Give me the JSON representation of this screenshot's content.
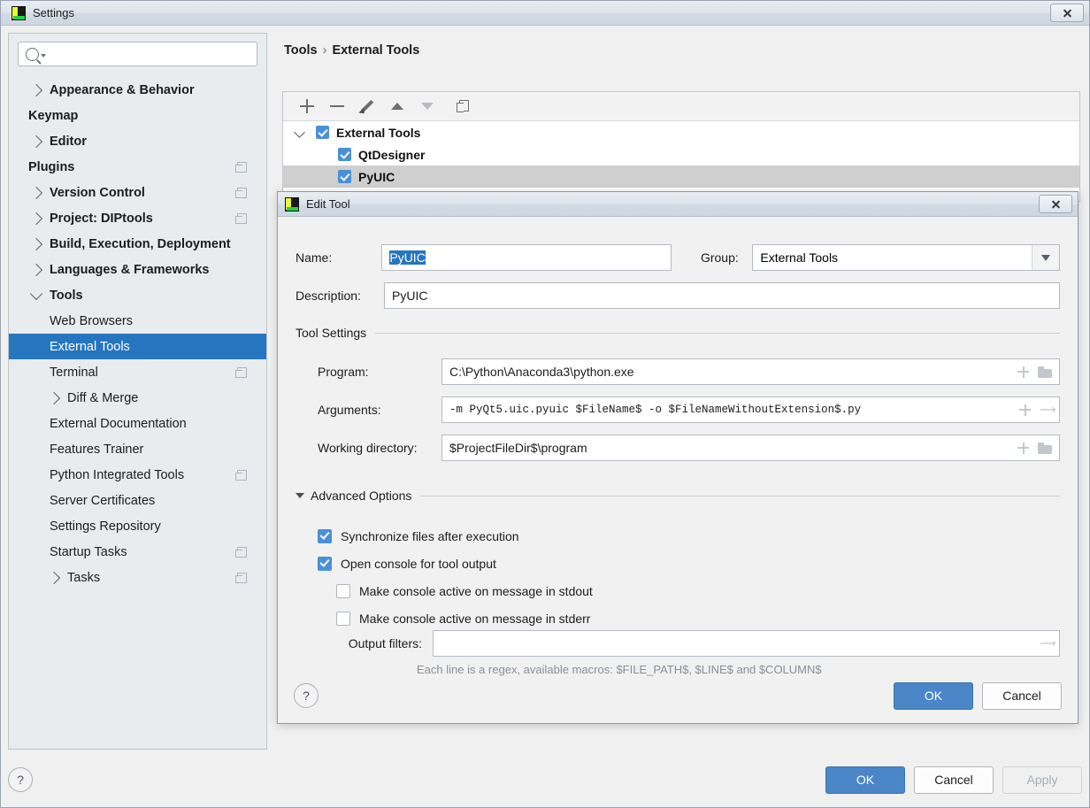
{
  "window": {
    "title": "Settings",
    "close_label": "Close",
    "app_icon": "pycharm-icon"
  },
  "search": {
    "placeholder": "",
    "icon": "search-icon"
  },
  "sidebar": {
    "items": [
      {
        "label": "Appearance & Behavior",
        "level": "top",
        "chevron": "right",
        "copy": false
      },
      {
        "label": "Keymap",
        "level": "top",
        "chevron": "none",
        "copy": false
      },
      {
        "label": "Editor",
        "level": "top",
        "chevron": "right",
        "copy": false
      },
      {
        "label": "Plugins",
        "level": "top",
        "chevron": "none",
        "copy": true
      },
      {
        "label": "Version Control",
        "level": "top",
        "chevron": "right",
        "copy": true
      },
      {
        "label": "Project: DIPtools",
        "level": "top",
        "chevron": "right",
        "copy": true
      },
      {
        "label": "Build, Execution, Deployment",
        "level": "top",
        "chevron": "right",
        "copy": false
      },
      {
        "label": "Languages & Frameworks",
        "level": "top",
        "chevron": "right",
        "copy": false
      },
      {
        "label": "Tools",
        "level": "top",
        "chevron": "down",
        "copy": false
      },
      {
        "label": "Web Browsers",
        "level": "child",
        "chevron": "none",
        "copy": false
      },
      {
        "label": "External Tools",
        "level": "child",
        "chevron": "none",
        "copy": false,
        "selected": true
      },
      {
        "label": "Terminal",
        "level": "child",
        "chevron": "none",
        "copy": true
      },
      {
        "label": "Diff & Merge",
        "level": "child",
        "chevron": "right",
        "copy": false
      },
      {
        "label": "External Documentation",
        "level": "child",
        "chevron": "none",
        "copy": false
      },
      {
        "label": "Features Trainer",
        "level": "child",
        "chevron": "none",
        "copy": false
      },
      {
        "label": "Python Integrated Tools",
        "level": "child",
        "chevron": "none",
        "copy": true
      },
      {
        "label": "Server Certificates",
        "level": "child",
        "chevron": "none",
        "copy": false
      },
      {
        "label": "Settings Repository",
        "level": "child",
        "chevron": "none",
        "copy": false
      },
      {
        "label": "Startup Tasks",
        "level": "child",
        "chevron": "none",
        "copy": true
      },
      {
        "label": "Tasks",
        "level": "child",
        "chevron": "right",
        "copy": true
      }
    ]
  },
  "content": {
    "breadcrumb": {
      "parent": "Tools",
      "separator": "›",
      "current": "External Tools"
    },
    "toolbar": [
      {
        "name": "add-button",
        "icon": "plus-icon"
      },
      {
        "name": "remove-button",
        "icon": "minus-icon"
      },
      {
        "name": "edit-button",
        "icon": "pencil-icon"
      },
      {
        "name": "move-up-button",
        "icon": "triangle-up-icon"
      },
      {
        "name": "move-down-button",
        "icon": "triangle-down-icon"
      },
      {
        "name": "copy-button",
        "icon": "copy-icon"
      }
    ],
    "tree": [
      {
        "label": "External Tools",
        "checked": true,
        "level": 0,
        "expanded": true,
        "selected": false
      },
      {
        "label": "QtDesigner",
        "checked": true,
        "level": 1,
        "selected": false
      },
      {
        "label": "PyUIC",
        "checked": true,
        "level": 1,
        "selected": true
      }
    ]
  },
  "footer": {
    "help_label": "?",
    "ok_label": "OK",
    "cancel_label": "Cancel",
    "apply_label": "Apply"
  },
  "dialog": {
    "title": "Edit Tool",
    "close_label": "Close",
    "name_label": "Name:",
    "name_value": "PyUIC",
    "group_label": "Group:",
    "group_value": "External Tools",
    "description_label": "Description:",
    "description_value": "PyUIC",
    "tool_settings_label": "Tool Settings",
    "program_label": "Program:",
    "program_value": "C:\\Python\\Anaconda3\\python.exe",
    "arguments_label": "Arguments:",
    "arguments_value": "-m PyQt5.uic.pyuic $FileName$ -o $FileNameWithoutExtension$.py",
    "working_dir_label": "Working directory:",
    "working_dir_value": "$ProjectFileDir$\\program",
    "advanced_options_label": "Advanced Options",
    "checkboxes": [
      {
        "label": "Synchronize files after execution",
        "checked": true,
        "indent": 0
      },
      {
        "label": "Open console for tool output",
        "checked": true,
        "indent": 0
      },
      {
        "label": "Make console active on message in stdout",
        "checked": false,
        "indent": 1
      },
      {
        "label": "Make console active on message in stderr",
        "checked": false,
        "indent": 1
      }
    ],
    "output_filters_label": "Output filters:",
    "output_filters_value": "",
    "output_filters_hint": "Each line is a regex, available macros: $FILE_PATH$, $LINE$ and $COLUMN$",
    "help_label": "?",
    "ok_label": "OK",
    "cancel_label": "Cancel"
  },
  "colors": {
    "selection_blue": "#2675bf",
    "primary_button": "#4a86c8",
    "checkbox_blue": "#4a90d9",
    "tree_selection_gray": "#cfcfcf"
  }
}
